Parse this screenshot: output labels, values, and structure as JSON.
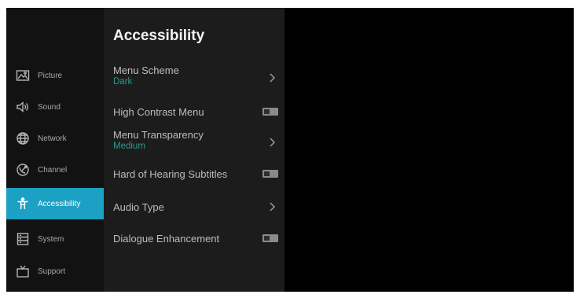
{
  "sidebar": {
    "items": [
      {
        "label": "Picture",
        "icon": "picture-icon",
        "active": false
      },
      {
        "label": "Sound",
        "icon": "speaker-icon",
        "active": false
      },
      {
        "label": "Network",
        "icon": "globe-icon",
        "active": false
      },
      {
        "label": "Channel",
        "icon": "satellite-dish-icon",
        "active": false
      },
      {
        "label": "Accessibility",
        "icon": "accessibility-person-icon",
        "active": true
      },
      {
        "label": "System",
        "icon": "system-list-icon",
        "active": false
      },
      {
        "label": "Support",
        "icon": "tv-icon",
        "active": false
      }
    ]
  },
  "panel": {
    "title": "Accessibility",
    "rows": [
      {
        "label": "Menu Scheme",
        "value": "Dark",
        "control": "chevron"
      },
      {
        "label": "High Contrast Menu",
        "control": "toggle",
        "on": false
      },
      {
        "label": "Menu Transparency",
        "value": "Medium",
        "control": "chevron"
      },
      {
        "label": "Hard of Hearing Subtitles",
        "control": "toggle",
        "on": false
      },
      {
        "label": "Audio Type",
        "control": "chevron"
      },
      {
        "label": "Dialogue Enhancement",
        "control": "toggle",
        "on": false
      }
    ]
  },
  "colors": {
    "accent": "#1ca0c4",
    "value_text": "#2a9a8e",
    "sidebar_bg": "#121212",
    "panel_bg": "#1c1c1c"
  }
}
